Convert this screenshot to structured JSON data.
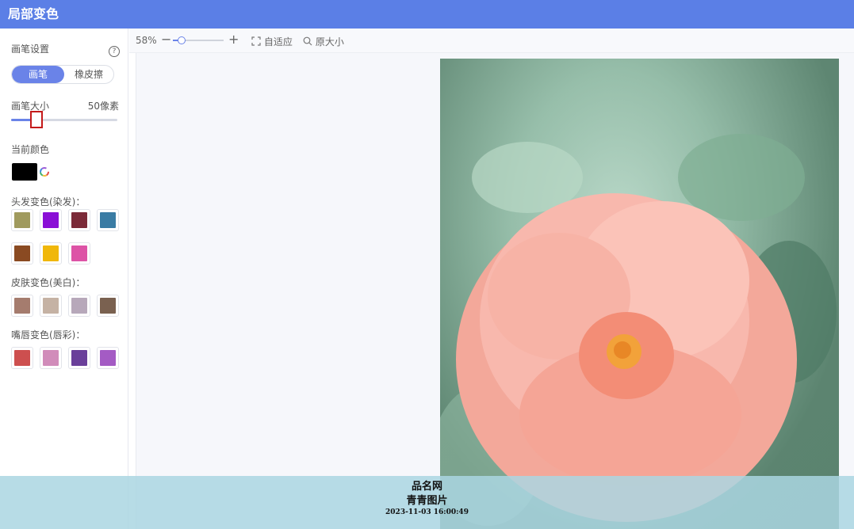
{
  "app": {
    "title": "局部变色"
  },
  "sidebar": {
    "brush_settings_label": "画笔设置",
    "help_icon": "question-circle-icon",
    "modes": [
      {
        "label": "画笔",
        "active": true
      },
      {
        "label": "橡皮擦",
        "active": false
      }
    ],
    "brush_size_label": "画笔大小",
    "brush_size_value": "50像素",
    "brush_size_fraction": 0.24,
    "current_color_label": "当前颜色",
    "current_color": "#000000",
    "color_picker_icon": "color-wheel-icon",
    "hair_label": "头发变色(染发)：",
    "hair_colors": [
      "#a09a5e",
      "#8a0fd6",
      "#7b2a38",
      "#3a7ca4",
      "#8a4a22",
      "#f0b70a",
      "#dd53a6"
    ],
    "skin_label": "皮肤变色(美白)：",
    "skin_colors": [
      "#a57c6e",
      "#c5b2a4",
      "#b7a8ba",
      "#7a6150"
    ],
    "lip_label": "嘴唇变色(唇彩)：",
    "lip_colors": [
      "#cd4f4f",
      "#d18cba",
      "#6a3f9a",
      "#a45bc4"
    ]
  },
  "toolbar": {
    "zoom_text": "58%",
    "zoom_fraction": 0.15,
    "minus_icon": "minus-icon",
    "plus_icon": "plus-icon",
    "fit_label": "自适应",
    "fit_icon": "fit-frame-icon",
    "original_label": "原大小",
    "original_icon": "zoom-magnifier-icon"
  },
  "watermark": {
    "line1": "品名网",
    "line2": "青青图片",
    "line3": "2023-11-03 16:00:49"
  }
}
